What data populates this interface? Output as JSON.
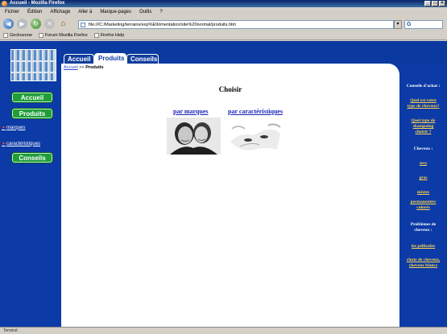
{
  "window": {
    "title": "Accueil - Mozilla Firefox",
    "buttons": [
      "_",
      "□",
      "×"
    ]
  },
  "menu": [
    "Fichier",
    "Édition",
    "Affichage",
    "Aller à",
    "Marque-pages",
    "Outils",
    "?"
  ],
  "toolbar": {
    "url": "file:///C:/Marketing/terrains/exp%E9rimentation/site%20normal/produits.htm",
    "go_label": "▾",
    "search_label": "G"
  },
  "bookmarks": [
    "Geckozone",
    "Forum Mozilla Firefox",
    "Firefox Help"
  ],
  "status": "Terminé",
  "sidebar": {
    "buttons": [
      "Accueil",
      "Produits",
      "Conseils"
    ],
    "sublinks": [
      "marques",
      "caractéristiques"
    ]
  },
  "tabs": [
    "Accueil",
    "Produits",
    "Conseils"
  ],
  "active_tab": "Produits",
  "breadcrumb": {
    "link": "Accueil",
    "separator": ">>",
    "current": "Produits"
  },
  "main": {
    "heading": "Choisir",
    "links": [
      "par marques",
      "par caractéristiques"
    ]
  },
  "right": {
    "advice_title": "Conseils d'achat :",
    "advice_links": [
      [
        "Quel est votre",
        "type de cheveux?"
      ],
      [
        "Quel type de",
        "shampoing",
        "choisir ?"
      ]
    ],
    "hair_title": "Cheveux :",
    "hair_links": [
      [
        "secs"
      ],
      [
        "gras"
      ],
      [
        "mixtes"
      ],
      [
        "permanentés/",
        "colorés"
      ]
    ],
    "problems_title": [
      "Problèmes de",
      "cheveux :"
    ],
    "problem_links": [
      [
        "les pellicules"
      ],
      [
        "chute de cheveux,",
        "cheveux blancs"
      ]
    ]
  },
  "colors": {
    "page_blue": "#0c3aa6",
    "button_green": "#1f9e3a",
    "right_link": "#ffd44a",
    "main_link": "#1a24b8"
  }
}
